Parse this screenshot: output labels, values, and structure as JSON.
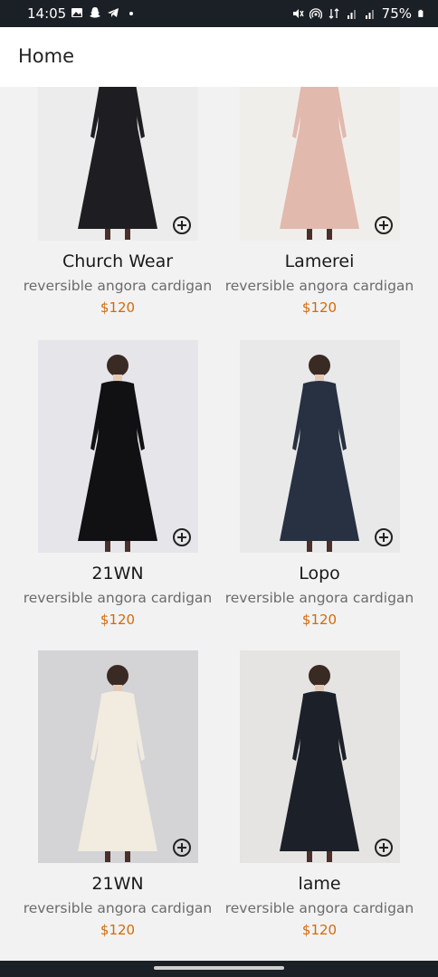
{
  "status_bar": {
    "time": "14:05",
    "battery": "75%",
    "left_icons": [
      "gallery-icon",
      "snapchat-icon",
      "telegram-icon",
      "dot-icon"
    ],
    "right_icons": [
      "mute-icon",
      "hotspot-icon",
      "data-icon",
      "signal-icon",
      "signal-icon",
      "battery-icon"
    ]
  },
  "app_bar": {
    "title": "Home"
  },
  "products": [
    {
      "name": "Church Wear",
      "subtitle": "reversible angora cardigan",
      "price": "$120",
      "dress_color": "#1e1e22",
      "bg": "#ececec"
    },
    {
      "name": "Lamerei",
      "subtitle": "reversible angora cardigan",
      "price": "$120",
      "dress_color": "#e2b9ad",
      "bg": "#f0eeeb"
    },
    {
      "name": "21WN",
      "subtitle": "reversible angora cardigan",
      "price": "$120",
      "dress_color": "#111114",
      "bg": "#e6e6ea"
    },
    {
      "name": "Lopo",
      "subtitle": "reversible angora cardigan",
      "price": "$120",
      "dress_color": "#273142",
      "bg": "#e9e9e9"
    },
    {
      "name": "21WN",
      "subtitle": "reversible angora cardigan",
      "price": "$120",
      "dress_color": "#f1ebe0",
      "bg": "#d4d4d6"
    },
    {
      "name": "lame",
      "subtitle": "reversible angora cardigan",
      "price": "$120",
      "dress_color": "#1c2028",
      "bg": "#e5e4e2"
    }
  ]
}
